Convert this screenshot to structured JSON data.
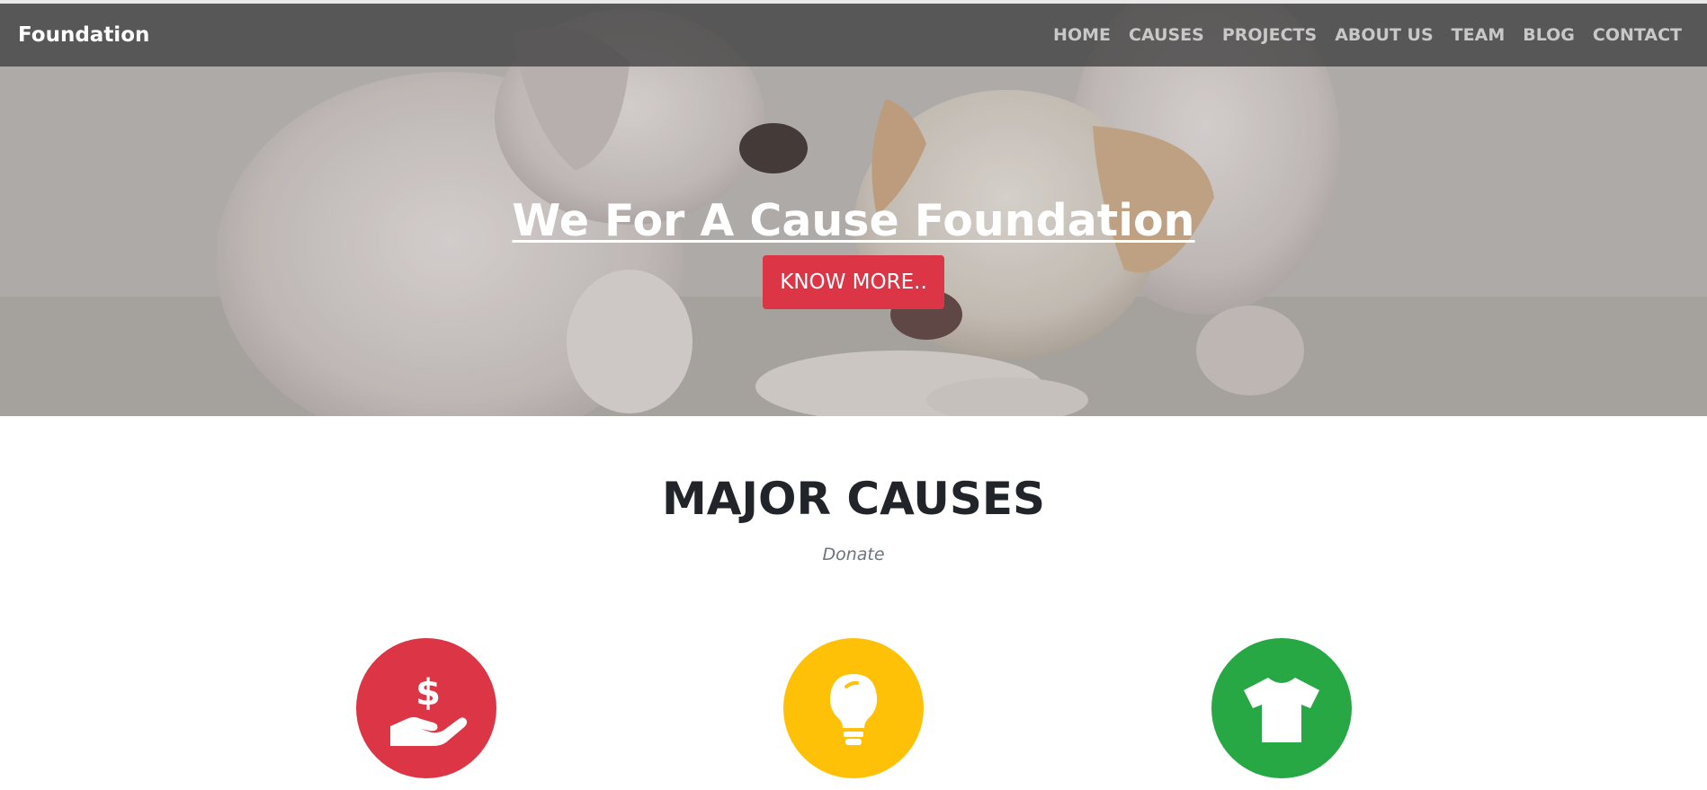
{
  "navbar": {
    "brand": "Foundation",
    "links": [
      "HOME",
      "CAUSES",
      "PROJECTS",
      "ABOUT US",
      "TEAM",
      "BLOG",
      "CONTACT"
    ]
  },
  "hero": {
    "title": "We For A Cause Foundation",
    "button_label": "KNOW MORE.."
  },
  "causes": {
    "title": "MAJOR CAUSES",
    "subtitle": "Donate",
    "items": [
      {
        "icon": "hand-holding-dollar-icon",
        "color": "#dc3545"
      },
      {
        "icon": "lightbulb-icon",
        "color": "#ffc107"
      },
      {
        "icon": "tshirt-icon",
        "color": "#28a745"
      }
    ]
  },
  "colors": {
    "accent_red": "#dc3545",
    "accent_yellow": "#ffc107",
    "accent_green": "#28a745",
    "heading": "#212529",
    "muted": "#6c757d"
  }
}
